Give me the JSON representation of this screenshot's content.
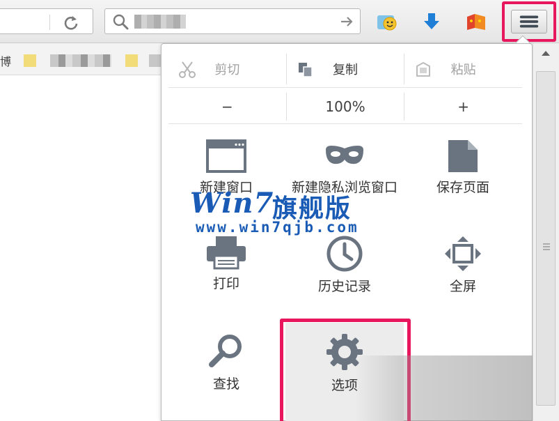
{
  "menu": {
    "edit": [
      {
        "label": "剪切",
        "icon": "scissors-icon",
        "enabled": false
      },
      {
        "label": "复制",
        "icon": "copy-icon",
        "enabled": true
      },
      {
        "label": "粘贴",
        "icon": "clipboard-icon",
        "enabled": false
      }
    ],
    "zoom": {
      "out": "−",
      "level": "100%",
      "in": "+"
    },
    "items": [
      {
        "label": "新建窗口",
        "icon": "window-icon"
      },
      {
        "label": "新建隐私浏览窗口",
        "icon": "mask-icon"
      },
      {
        "label": "保存页面",
        "icon": "page-icon"
      },
      {
        "label": "打印",
        "icon": "printer-icon"
      },
      {
        "label": "历史记录",
        "icon": "clock-icon"
      },
      {
        "label": "全屏",
        "icon": "fullscreen-icon"
      },
      {
        "label": "查找",
        "icon": "magnifier-icon"
      },
      {
        "label": "选项",
        "icon": "gear-icon"
      }
    ]
  },
  "bookmarks": {
    "text": "博"
  },
  "watermark": {
    "logo": "Win7",
    "name": "旗舰版",
    "url": "www.win7qjb.com"
  },
  "colors": {
    "highlight": "#e8175d",
    "icon": "#6a7480",
    "watermark": "#1a5bb6"
  }
}
